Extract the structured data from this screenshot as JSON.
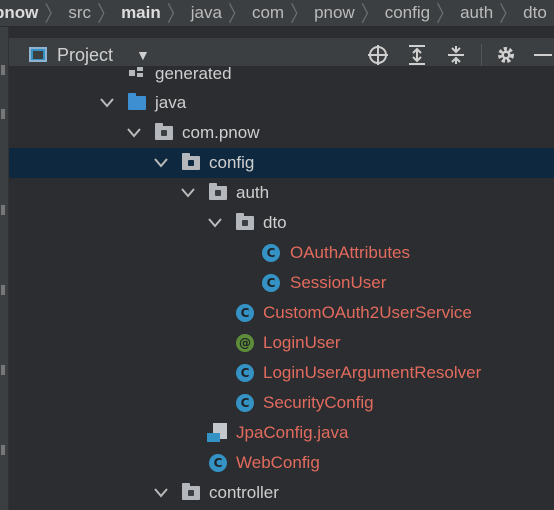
{
  "breadcrumb": {
    "items": [
      "pnow",
      "src",
      "main",
      "java",
      "com",
      "pnow",
      "config",
      "auth",
      "dto"
    ],
    "bold_index": [
      0,
      2
    ],
    "last_icon": "class-c-icon",
    "last_icon_glyph": "C"
  },
  "panel": {
    "title": "Project",
    "dropdown_glyph": "▼",
    "tools": {
      "locate_icon": "crosshair-icon",
      "expand_icon": "expand-all-icon",
      "collapse_icon": "collapse-all-icon",
      "settings_icon": "gear-icon",
      "hide_icon": "minimize-icon"
    }
  },
  "tree": {
    "rows": [
      {
        "label": "generated",
        "type": "generated",
        "depth": 4
      },
      {
        "label": "java",
        "type": "folder-blue",
        "depth": 3,
        "expanded": true
      },
      {
        "label": "com.pnow",
        "type": "package",
        "depth": 4,
        "expanded": true
      },
      {
        "label": "config",
        "type": "package",
        "depth": 5,
        "expanded": true,
        "selected": true
      },
      {
        "label": "auth",
        "type": "package",
        "depth": 6,
        "expanded": true
      },
      {
        "label": "dto",
        "type": "package",
        "depth": 7,
        "expanded": true
      },
      {
        "label": "OAuthAttributes",
        "type": "class",
        "depth": 9
      },
      {
        "label": "SessionUser",
        "type": "class",
        "depth": 9
      },
      {
        "label": "CustomOAuth2UserService",
        "type": "class",
        "depth": 8
      },
      {
        "label": "LoginUser",
        "type": "annotation",
        "depth": 8
      },
      {
        "label": "LoginUserArgumentResolver",
        "type": "class",
        "depth": 8
      },
      {
        "label": "SecurityConfig",
        "type": "class",
        "depth": 8
      },
      {
        "label": "JpaConfig.java",
        "type": "javafile",
        "depth": 7
      },
      {
        "label": "WebConfig",
        "type": "class",
        "depth": 7
      },
      {
        "label": "controller",
        "type": "package",
        "depth": 5,
        "expanded": true
      }
    ],
    "class_glyph": "C",
    "annotation_glyph": "@",
    "error_color": "#e36b5e",
    "selection_color": "#0e293f"
  }
}
